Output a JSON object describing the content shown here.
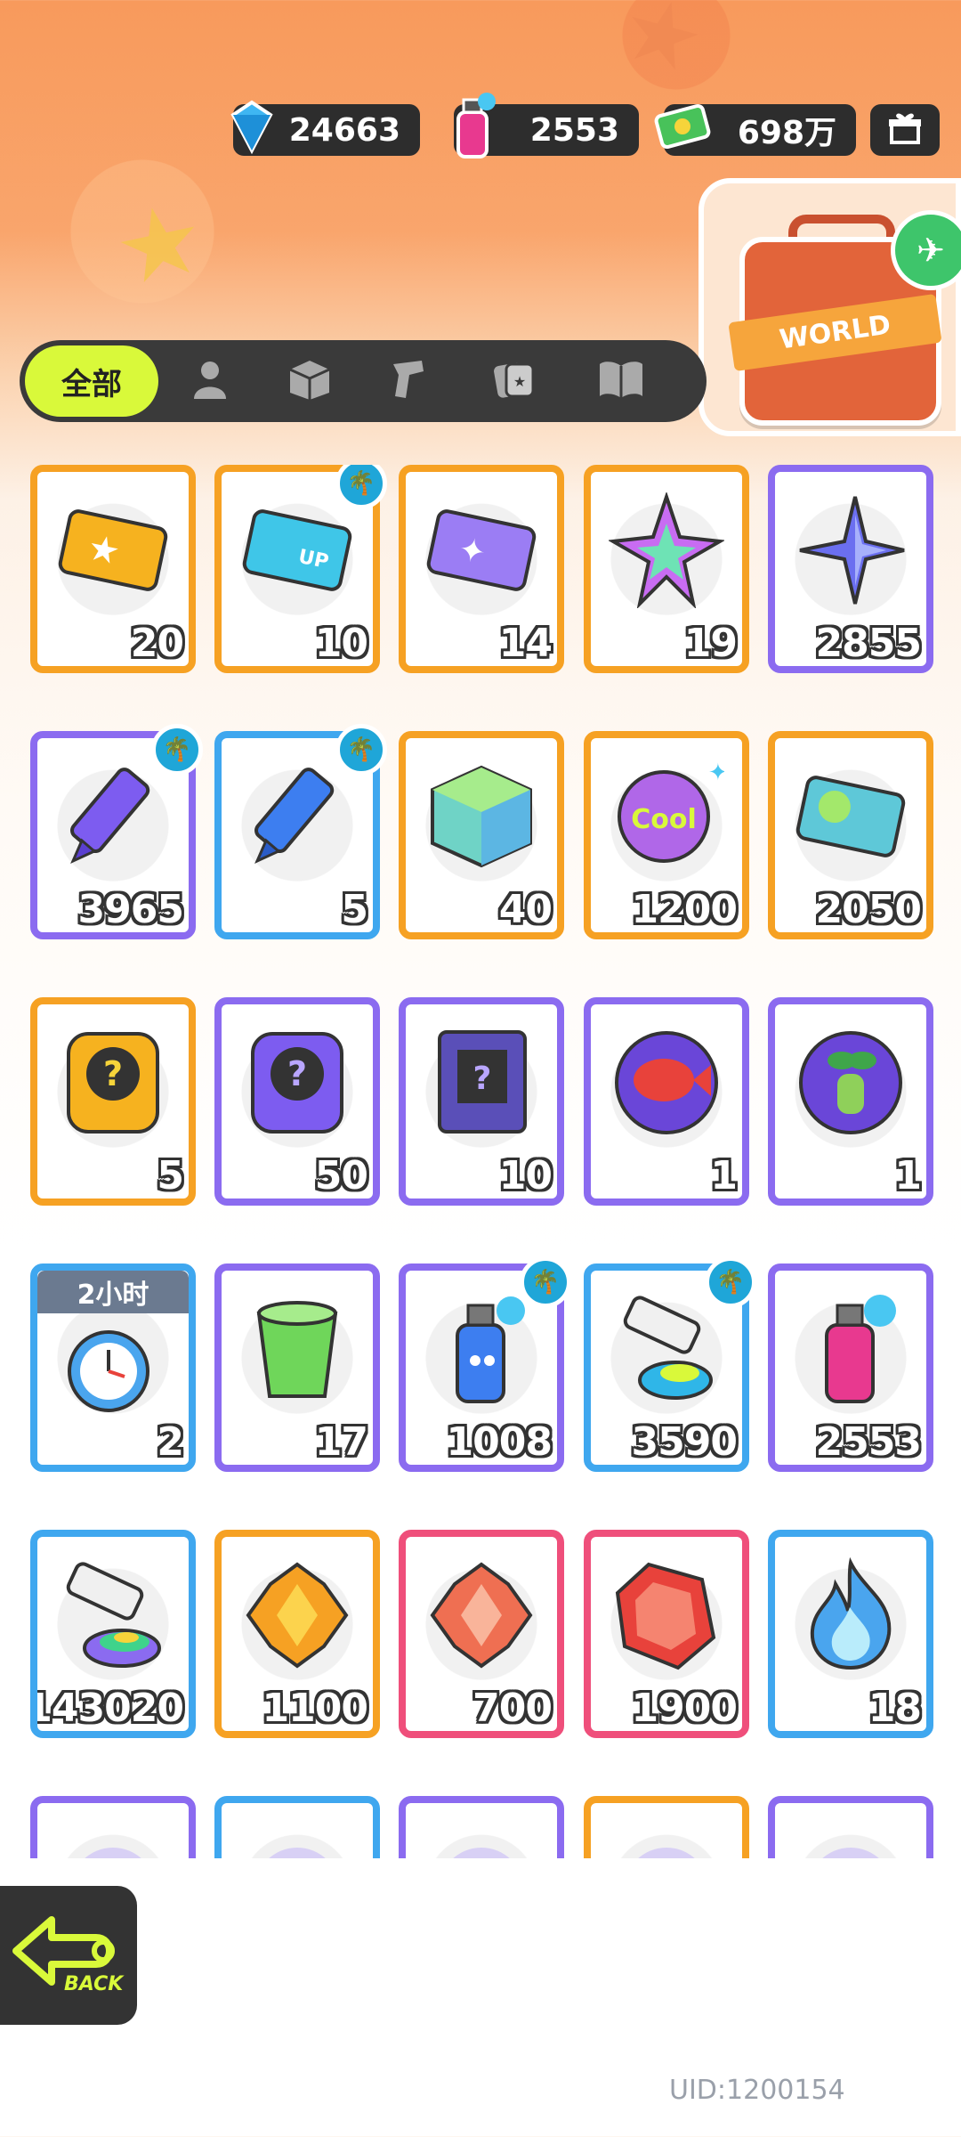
{
  "currencies": [
    {
      "name": "gem",
      "value": "24663"
    },
    {
      "name": "spray",
      "value": "2553"
    },
    {
      "name": "cash",
      "value": "698万"
    }
  ],
  "world_label": "WORLD",
  "tabs": {
    "all_label": "全部",
    "icons": [
      "person-icon",
      "box-icon",
      "pistol-icon",
      "sticker-icon",
      "book-icon"
    ]
  },
  "items": [
    {
      "id": "gold-ticket",
      "count": "20",
      "frame": "orange",
      "icon": "gold-ticket-icon",
      "badge": false
    },
    {
      "id": "blue-up-ticket",
      "count": "10",
      "frame": "orange",
      "icon": "blue-ticket-icon",
      "badge": true
    },
    {
      "id": "purple-ticket",
      "count": "14",
      "frame": "orange",
      "icon": "purple-ticket-icon",
      "badge": false
    },
    {
      "id": "rainbow-star",
      "count": "19",
      "frame": "orange",
      "icon": "rainbow-star-icon",
      "badge": false
    },
    {
      "id": "purple-star",
      "count": "2855",
      "frame": "purple",
      "icon": "purple-star-icon",
      "badge": false
    },
    {
      "id": "purple-crayon",
      "count": "3965",
      "frame": "purple",
      "icon": "purple-crayon-icon",
      "badge": true
    },
    {
      "id": "blue-crayon",
      "count": "5",
      "frame": "blue",
      "icon": "blue-crayon-icon",
      "badge": true
    },
    {
      "id": "color-cube",
      "count": "40",
      "frame": "orange",
      "icon": "color-cube-icon",
      "badge": false
    },
    {
      "id": "cool-badge",
      "count": "1200",
      "frame": "orange",
      "icon": "cool-badge-icon",
      "badge": false
    },
    {
      "id": "season-ticket",
      "count": "2050",
      "frame": "orange",
      "icon": "season-ticket-icon",
      "badge": false
    },
    {
      "id": "deity-mystery-gold",
      "count": "5",
      "frame": "orange",
      "icon": "mystery-gold-icon",
      "badge": false
    },
    {
      "id": "deity-mystery-purple",
      "count": "50",
      "frame": "purple",
      "icon": "mystery-purple-icon",
      "badge": false
    },
    {
      "id": "travel-card-mystery",
      "count": "10",
      "frame": "purple",
      "icon": "travel-card-icon",
      "badge": false
    },
    {
      "id": "mpets-fish",
      "count": "1",
      "frame": "purple",
      "icon": "fish-pet-icon",
      "badge": false
    },
    {
      "id": "mpets-sprout",
      "count": "1",
      "frame": "purple",
      "icon": "sprout-pet-icon",
      "badge": false
    },
    {
      "id": "alarm-clock",
      "count": "2",
      "frame": "blue",
      "icon": "alarm-clock-icon",
      "badge": false,
      "timer": "2小时"
    },
    {
      "id": "green-cup",
      "count": "17",
      "frame": "purple",
      "icon": "green-cup-icon",
      "badge": false
    },
    {
      "id": "blue-spray",
      "count": "1008",
      "frame": "purple",
      "icon": "blue-spray-icon",
      "badge": true
    },
    {
      "id": "paint-tube-blue",
      "count": "3590",
      "frame": "blue",
      "icon": "paint-tube-icon",
      "badge": true
    },
    {
      "id": "pink-spray",
      "count": "2553",
      "frame": "purple",
      "icon": "pink-spray-icon",
      "badge": false
    },
    {
      "id": "rainbow-paint",
      "count": "143020",
      "frame": "blue",
      "icon": "rainbow-paint-icon",
      "badge": false
    },
    {
      "id": "gold-crystal",
      "count": "1100",
      "frame": "orange",
      "icon": "gold-crystal-icon",
      "badge": false
    },
    {
      "id": "red-crystal",
      "count": "700",
      "frame": "pink",
      "icon": "red-crystal-icon",
      "badge": false
    },
    {
      "id": "red-gem",
      "count": "1900",
      "frame": "pink",
      "icon": "red-gem-icon",
      "badge": false
    },
    {
      "id": "blue-flame",
      "count": "18",
      "frame": "blue",
      "icon": "blue-flame-icon",
      "badge": false
    },
    {
      "id": "partial-1",
      "count": "",
      "frame": "purple",
      "icon": "partial-icon",
      "badge": false
    },
    {
      "id": "partial-2",
      "count": "",
      "frame": "blue",
      "icon": "partial-icon",
      "badge": false
    },
    {
      "id": "partial-3",
      "count": "",
      "frame": "purple",
      "icon": "partial-icon",
      "badge": false
    },
    {
      "id": "partial-4",
      "count": "",
      "frame": "orange",
      "icon": "partial-icon",
      "badge": false
    },
    {
      "id": "partial-5",
      "count": "",
      "frame": "purple",
      "icon": "partial-icon",
      "badge": false
    }
  ],
  "back_label": "BACK",
  "uid": "UID:1200154",
  "colors": {
    "accent": "#d9f93a",
    "frame_orange": "#f6a123",
    "frame_purple": "#8b6bf0",
    "frame_blue": "#3fa7ef",
    "frame_pink": "#ef4f7b"
  }
}
